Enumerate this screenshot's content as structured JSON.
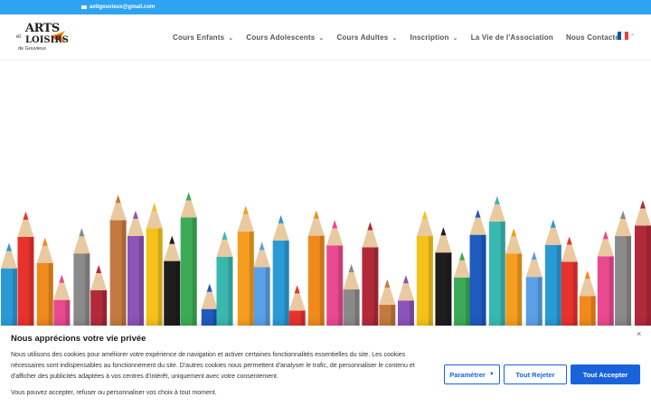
{
  "topbar": {
    "email": "aetlgouvieux@gmail.com",
    "icon": "mail-icon"
  },
  "logo": {
    "line1": "ARTS",
    "line2": "et",
    "line3": "LOISIRS",
    "line4": "de Gouvieux"
  },
  "nav": {
    "items": [
      {
        "label": "Cours Enfants",
        "has_dropdown": true
      },
      {
        "label": "Cours Adolescents",
        "has_dropdown": true
      },
      {
        "label": "Cours Adultes",
        "has_dropdown": true
      },
      {
        "label": "Inscription",
        "has_dropdown": true
      },
      {
        "label": "La Vie de l'Association",
        "has_dropdown": false
      },
      {
        "label": "Nous Contacter",
        "has_dropdown": false
      }
    ],
    "chevron": "⌄",
    "language_icon": "french-flag-icon"
  },
  "cookie": {
    "title": "Nous apprécions votre vie privée",
    "close": "×",
    "text": "Nous utilisons des cookies pour améliorer votre expérience de navigation et activer certaines fonctionnalités essentielles du site. Les cookies nécessaires sont indispensables au fonctionnement du site. D'autres cookies nous permettent d'analyser le trafic, de personnaliser le contenu et d'afficher des publicités adaptées à vos centres d'intérêt, uniquement avec votre consentement.",
    "text2": "Vous pouvez accepter, refuser ou personnaliser vos choix à tout moment.",
    "param_label": "Paramétrer",
    "reject_label": "Tout Rejeter",
    "accept_label": "Tout Accepter"
  },
  "colors": {
    "topbar": "#2ea3f2",
    "accent": "#1863dc",
    "flag": [
      "#0055a4",
      "#ffffff",
      "#ef4135"
    ],
    "pencils": [
      "#2a9ad6",
      "#e8322e",
      "#f08a1c",
      "#e9498f",
      "#8a8a8a",
      "#b22a3a",
      "#c47a3e",
      "#8c53b8",
      "#f6c219",
      "#1e1e1e",
      "#3cab57",
      "#1f5bbf",
      "#39b8b0",
      "#f59d1e",
      "#5aa0e6"
    ]
  }
}
